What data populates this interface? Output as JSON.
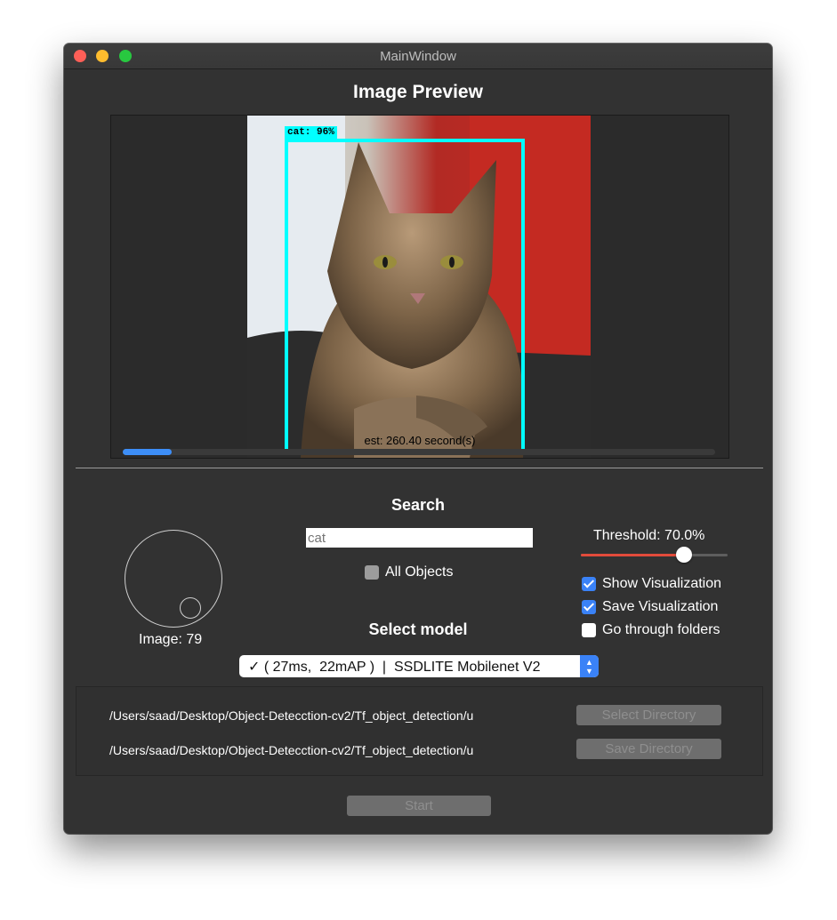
{
  "window": {
    "title": "MainWindow"
  },
  "preview": {
    "heading": "Image Preview",
    "detection_label": "cat: 96%",
    "estimate_text": "est: 260.40 second(s)",
    "progress_fraction": 0.083
  },
  "image_counter": {
    "label": "Image: 79"
  },
  "search": {
    "heading": "Search",
    "value": "",
    "placeholder": "cat",
    "all_objects_label": "All Objects"
  },
  "threshold": {
    "label": "Threshold: 70.0%",
    "value": 0.7
  },
  "options": {
    "show_visualization": "Show Visualization",
    "save_visualization": "Save Visualization",
    "go_through_folders": "Go through folders"
  },
  "model": {
    "heading": "Select model",
    "selected": "✓ ( 27ms,  22mAP )  |  SSDLITE Mobilenet V2"
  },
  "directories": {
    "select_path": "/Users/saad/Desktop/Object-Detecction-cv2/Tf_object_detection/u",
    "save_path": "/Users/saad/Desktop/Object-Detecction-cv2/Tf_object_detection/u",
    "select_button": "Select Directory",
    "save_button": "Save Directory"
  },
  "start_button": "Start",
  "colors": {
    "window_bg": "#323232",
    "detection_box": "#00ffff",
    "accent_blue": "#3a82f7",
    "slider_red": "#e24b3b"
  }
}
